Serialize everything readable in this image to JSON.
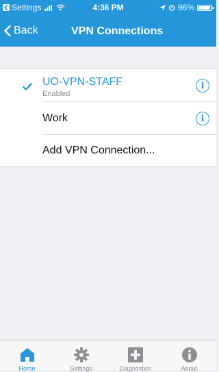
{
  "status_bar": {
    "carrier": "Settings",
    "time": "4:36 PM",
    "battery": "96%",
    "battery_level": 0.96
  },
  "nav": {
    "back_label": "Back",
    "title": "VPN Connections"
  },
  "vpn_list": [
    {
      "name": "UO-VPN-STAFF",
      "status": "Enabled",
      "selected": true
    },
    {
      "name": "Work",
      "status": "",
      "selected": false
    }
  ],
  "add_connection_label": "Add VPN Connection...",
  "tabs": [
    {
      "label": "Home",
      "icon": "home-icon",
      "active": true
    },
    {
      "label": "Settings",
      "icon": "gear-icon",
      "active": false
    },
    {
      "label": "Diagnostics",
      "icon": "plus-square-icon",
      "active": false
    },
    {
      "label": "About",
      "icon": "info-icon",
      "active": false
    }
  ],
  "colors": {
    "accent": "#2596d9",
    "header_bg": "#2596d9",
    "background": "#efeff4",
    "tab_inactive": "#8e8e93"
  }
}
